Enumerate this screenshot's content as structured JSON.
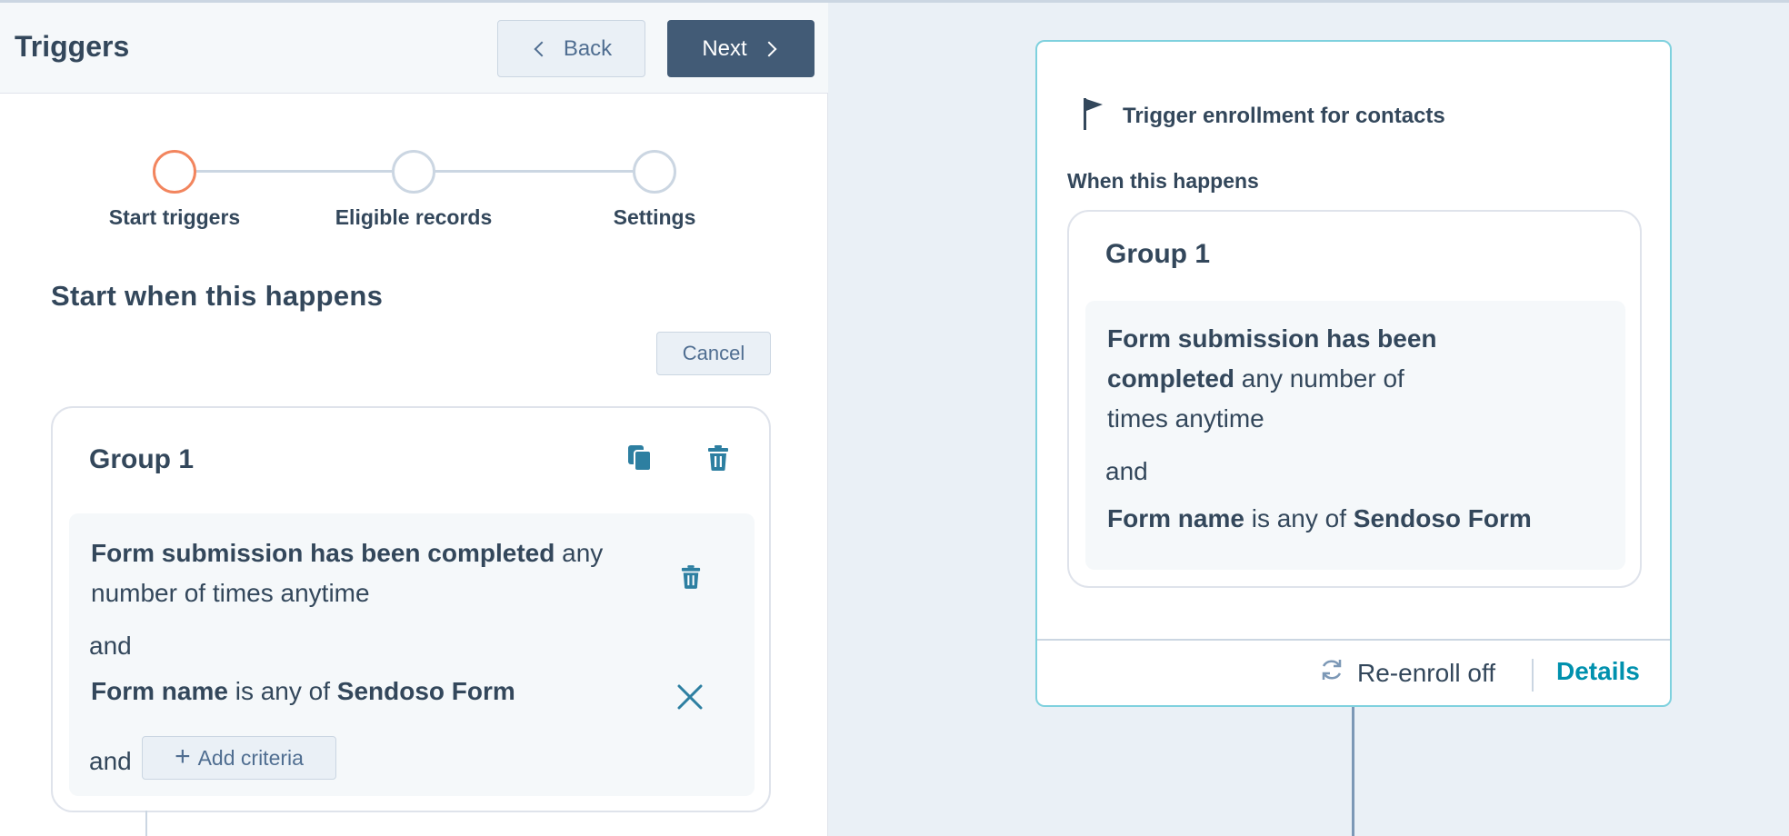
{
  "header": {
    "title": "Triggers",
    "back_label": "Back",
    "next_label": "Next"
  },
  "stepper": {
    "steps": [
      "Start triggers",
      "Eligible records",
      "Settings"
    ],
    "active_index": 0
  },
  "section": {
    "title": "Start when this happens",
    "cancel_label": "Cancel"
  },
  "group": {
    "title": "Group 1",
    "criteria": [
      {
        "bold": "Form submission has been completed",
        "rest_line1": " any",
        "rest_line2": "number of times anytime"
      },
      {
        "bold1": "Form name",
        "middle": " is any of ",
        "bold2": "Sendoso Form"
      }
    ],
    "and_label": "and",
    "add_criteria_label": "Add criteria"
  },
  "summary_card": {
    "title": "Trigger enrollment for contacts",
    "when_label": "When this happens",
    "group_title": "Group 1",
    "criteria_bold_line1": "Form submission has been",
    "criteria_bold_line2": "completed",
    "criteria_rest_line2": " any number of",
    "criteria_line3": "times anytime",
    "and_label": "and",
    "form_name_label": "Form name",
    "form_name_middle": " is any of ",
    "form_name_value": "Sendoso Form",
    "reenroll_label": "Re-enroll off",
    "details_label": "Details"
  },
  "colors": {
    "primary_dark": "#425b76",
    "text": "#33475b",
    "active_step": "#f2855e",
    "teal_accent": "#0091ae",
    "card_border": "#7fd1de"
  }
}
